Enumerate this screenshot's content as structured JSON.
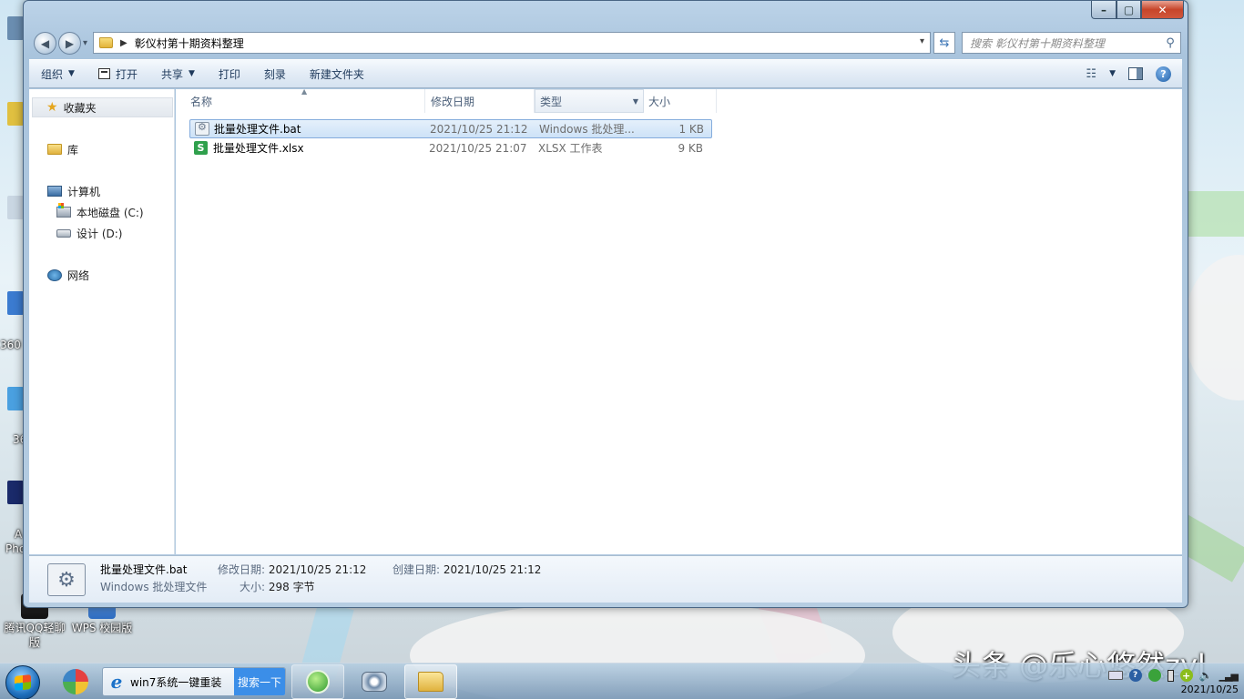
{
  "window": {
    "address_path": "彰仪村第十期资料整理",
    "search_placeholder": "搜索 彰仪村第十期资料整理",
    "controls": {
      "minimize": "–",
      "maximize": "▢",
      "close": "✕"
    }
  },
  "toolbar": {
    "organize": "组织",
    "open": "打开",
    "share": "共享",
    "print": "打印",
    "burn": "刻录",
    "new_folder": "新建文件夹"
  },
  "sidebar": {
    "favorites": "收藏夹",
    "libraries": "库",
    "computer": "计算机",
    "drive_c": "本地磁盘 (C:)",
    "drive_d": "设计 (D:)",
    "network": "网络"
  },
  "columns": {
    "name": "名称",
    "date": "修改日期",
    "type": "类型",
    "size": "大小"
  },
  "files": [
    {
      "name": "批量处理文件.bat",
      "date": "2021/10/25 21:12",
      "type": "Windows 批处理...",
      "size": "1 KB",
      "icon": "bat-file-icon",
      "selected": true
    },
    {
      "name": "批量处理文件.xlsx",
      "date": "2021/10/25 21:07",
      "type": "XLSX 工作表",
      "size": "9 KB",
      "icon": "xlsx-file-icon",
      "selected": false
    }
  ],
  "details": {
    "name": "批量处理文件.bat",
    "type": "Windows 批处理文件",
    "modified_label": "修改日期:",
    "modified_value": "2021/10/25 21:12",
    "created_label": "创建日期:",
    "created_value": "2021/10/25 21:12",
    "size_label": "大小:",
    "size_value": "298 字节"
  },
  "desktop": {
    "icons": [
      {
        "label": "腾讯QQ轻聊\n版"
      },
      {
        "label": "WPS 校园版"
      }
    ],
    "strip_labels": [
      "360",
      "36",
      "A",
      "Pho"
    ]
  },
  "taskbar": {
    "browser_title": "win7系统一键重装",
    "browser_search_button": "搜索一下",
    "clock_date": "2021/10/25"
  },
  "watermark": "头条 @乐心悠然zyl",
  "colors": {
    "selection": "#cde2f7",
    "xlsx_green": "#2fa04c",
    "taskbar_search": "#3b8ee8"
  }
}
